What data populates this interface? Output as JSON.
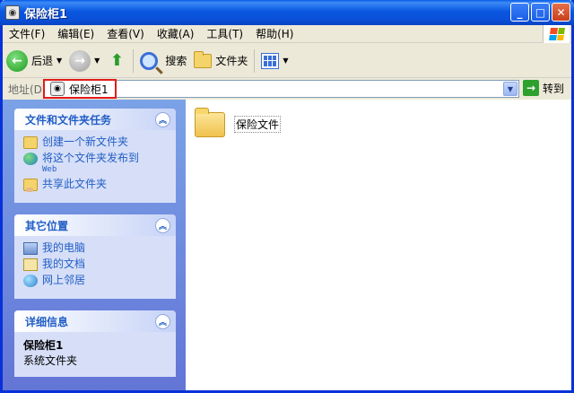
{
  "window": {
    "title": "保险柜1"
  },
  "menu": [
    "文件(F)",
    "编辑(E)",
    "查看(V)",
    "收藏(A)",
    "工具(T)",
    "帮助(H)"
  ],
  "toolbar": {
    "back": "后退",
    "search": "搜索",
    "folders": "文件夹"
  },
  "address": {
    "label": "地址(D)",
    "value": "保险柜1",
    "go": "转到"
  },
  "tasks_panel": {
    "title": "文件和文件夹任务",
    "items": [
      {
        "label": "创建一个新文件夹"
      },
      {
        "label": "将这个文件夹发布到",
        "sub": "Web"
      },
      {
        "label": "共享此文件夹"
      }
    ]
  },
  "places_panel": {
    "title": "其它位置",
    "items": [
      {
        "label": "我的电脑"
      },
      {
        "label": "我的文档"
      },
      {
        "label": "网上邻居"
      }
    ]
  },
  "details_panel": {
    "title": "详细信息",
    "name": "保险柜1",
    "type": "系统文件夹"
  },
  "content": {
    "items": [
      {
        "label": "保险文件"
      }
    ]
  },
  "colors": {
    "titlebar": "#0a57e0",
    "link": "#215dc6",
    "highlight": "#e21b1b"
  }
}
